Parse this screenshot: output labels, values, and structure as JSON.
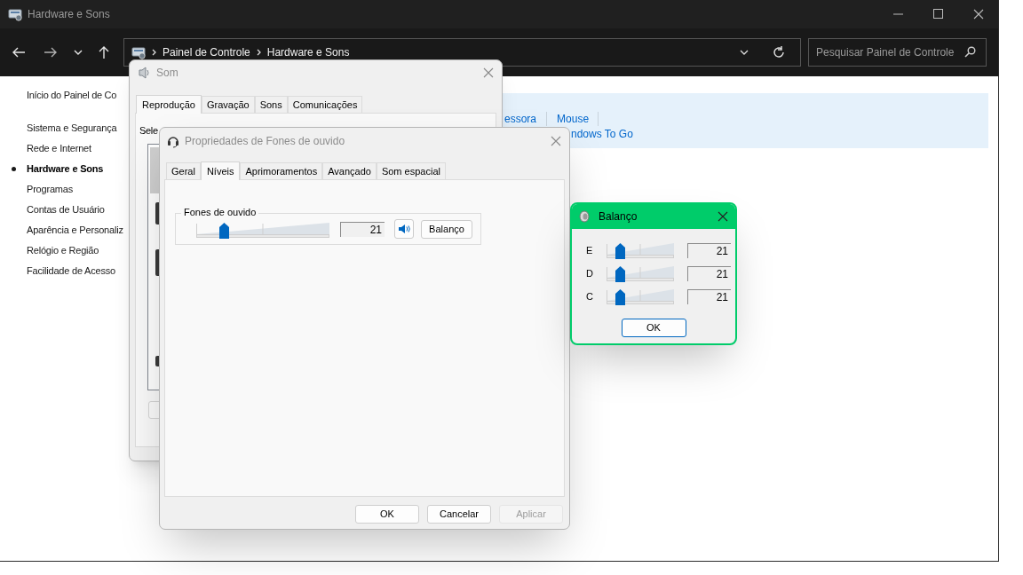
{
  "explorer": {
    "title": "Hardware e Sons",
    "breadcrumb": [
      "Painel de Controle",
      "Hardware e Sons"
    ],
    "search": {
      "placeholder": "Pesquisar Painel de Controle"
    },
    "sidebar": {
      "home": "Início do Painel de Co",
      "items": [
        {
          "label": "Sistema e Segurança",
          "selected": false
        },
        {
          "label": "Rede e Internet",
          "selected": false
        },
        {
          "label": "Hardware e Sons",
          "selected": true
        },
        {
          "label": "Programas",
          "selected": false
        },
        {
          "label": "Contas de Usuário",
          "selected": false
        },
        {
          "label": "Aparência e Personaliz",
          "selected": false
        },
        {
          "label": "Relógio e Região",
          "selected": false
        },
        {
          "label": "Facilidade de Acesso",
          "selected": false
        }
      ]
    },
    "links": [
      [
        "essora",
        "Mouse"
      ],
      [
        "ndows To Go"
      ]
    ]
  },
  "sound_dialog": {
    "title": "Som",
    "active": false,
    "tabs": [
      {
        "label": "Reprodução",
        "selected": true
      },
      {
        "label": "Gravação",
        "selected": false
      },
      {
        "label": "Sons",
        "selected": false
      },
      {
        "label": "Comunicações",
        "selected": false
      }
    ],
    "instruction": "Sele"
  },
  "properties_dialog": {
    "title": "Propriedades de Fones de ouvido",
    "active": false,
    "tabs": [
      {
        "label": "Geral",
        "selected": false
      },
      {
        "label": "Níveis",
        "selected": true
      },
      {
        "label": "Aprimoramentos",
        "selected": false
      },
      {
        "label": "Avançado",
        "selected": false
      },
      {
        "label": "Som espacial",
        "selected": false
      }
    ],
    "group": {
      "label": "Fones de ouvido",
      "level": 0.21,
      "reading": "21",
      "muted": false,
      "button": "Balanço"
    },
    "buttons": [
      {
        "label": "OK",
        "disabled": false
      },
      {
        "label": "Cancelar",
        "disabled": false
      },
      {
        "label": "Aplicar",
        "disabled": true
      }
    ]
  },
  "balance_dialog": {
    "title": "Balanço",
    "active": true,
    "channels": [
      {
        "name": "E",
        "level": 0.21,
        "reading": "21"
      },
      {
        "name": "D",
        "level": 0.21,
        "reading": "21"
      },
      {
        "name": "C",
        "level": 0.21,
        "reading": "21"
      }
    ],
    "button": "OK"
  }
}
